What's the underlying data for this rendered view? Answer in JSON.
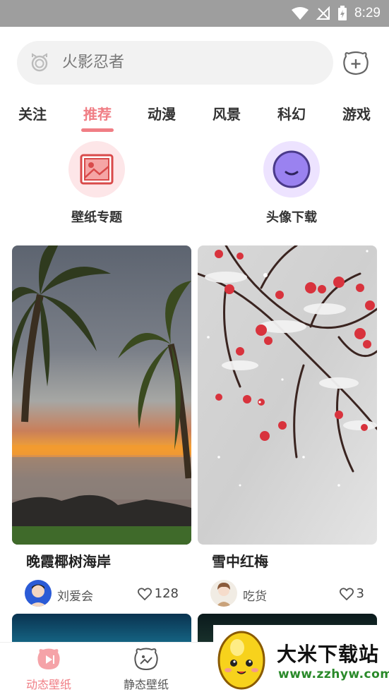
{
  "status_bar": {
    "time": "8:29"
  },
  "search": {
    "placeholder": "火影忍者"
  },
  "tabs": [
    {
      "label": "关注",
      "active": false
    },
    {
      "label": "推荐",
      "active": true
    },
    {
      "label": "动漫",
      "active": false
    },
    {
      "label": "风景",
      "active": false
    },
    {
      "label": "科幻",
      "active": false
    },
    {
      "label": "游戏",
      "active": false
    }
  ],
  "shortcuts": [
    {
      "label": "壁纸专题",
      "icon": "picture-frame-icon"
    },
    {
      "label": "头像下载",
      "icon": "smiley-face-icon"
    }
  ],
  "cards": [
    {
      "title": "晚霞椰树海岸",
      "user": "刘爱会",
      "likes": "128",
      "image": "sunset-palm-beach"
    },
    {
      "title": "雪中红梅",
      "user": "吃货",
      "likes": "3",
      "image": "red-berries-in-snow"
    }
  ],
  "bottom_nav": [
    {
      "label": "动态壁纸",
      "active": true
    },
    {
      "label": "静态壁纸",
      "active": false
    }
  ],
  "watermark": {
    "title": "大米下载站",
    "url": "www.zzhyw.com"
  },
  "colors": {
    "accent": "#f07e85",
    "status_bar": "#9e9e9e",
    "search_bg": "#f2f2f2",
    "avatar_circle_bg": "#ede3ff"
  }
}
